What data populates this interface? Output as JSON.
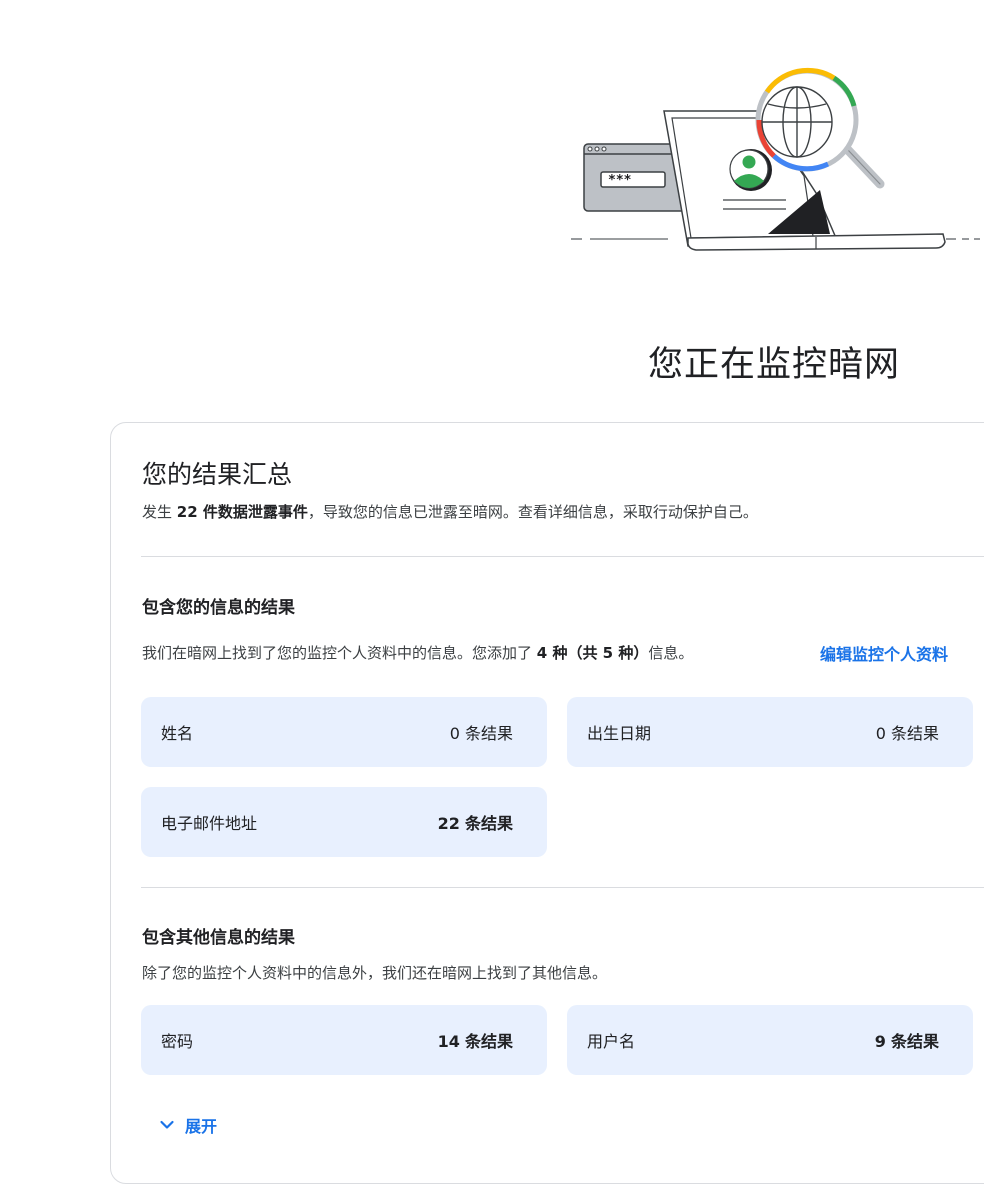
{
  "page": {
    "title": "您正在监控暗网"
  },
  "illustration": {
    "password_mask": "***"
  },
  "summary": {
    "title": "您的结果汇总",
    "pre": "发生 ",
    "bold": "22 件数据泄露事件",
    "post": "，导致您的信息已泄露至暗网。查看详细信息，采取行动保护自己。"
  },
  "section_profile": {
    "heading": "包含您的信息的结果",
    "desc_pre": "我们在暗网上找到了您的监控个人资料中的信息。您添加了 ",
    "desc_bold": "4 种（共 5 种）",
    "desc_post": "信息。",
    "edit_link": "编辑监控个人资料",
    "tiles": [
      {
        "label": "姓名",
        "count": "0",
        "unit": "条结果"
      },
      {
        "label": "出生日期",
        "count": "0",
        "unit": "条结果"
      },
      {
        "label": "电子邮件地址",
        "count": "22",
        "unit": "条结果"
      }
    ]
  },
  "section_other": {
    "heading": "包含其他信息的结果",
    "desc": "除了您的监控个人资料中的信息外，我们还在暗网上找到了其他信息。",
    "tiles": [
      {
        "label": "密码",
        "count": "14",
        "unit": "条结果"
      },
      {
        "label": "用户名",
        "count": "9",
        "unit": "条结果"
      }
    ]
  },
  "expand": {
    "label": "展开"
  },
  "colors": {
    "accent": "#1a73e8",
    "tile_bg": "#e8f0fe"
  }
}
